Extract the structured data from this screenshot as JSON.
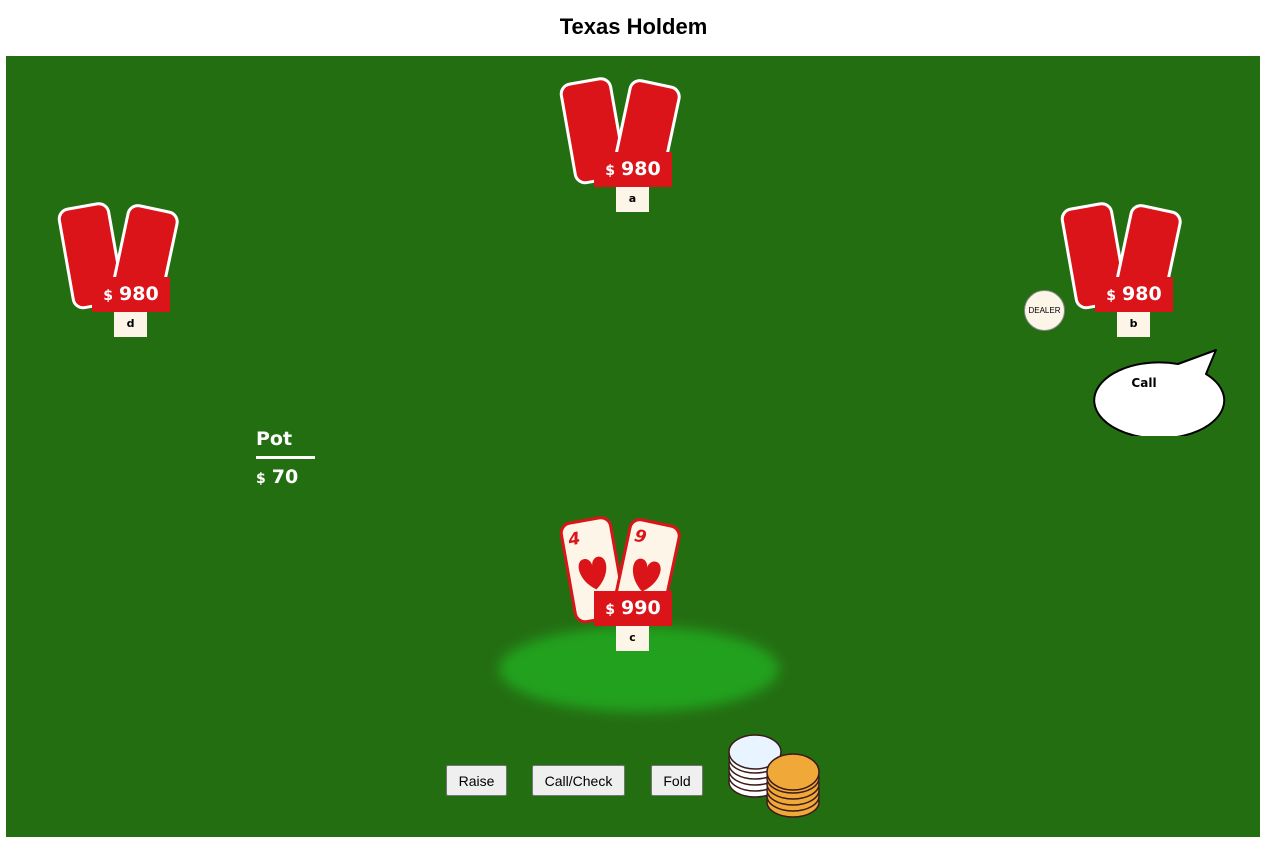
{
  "title": "Texas Holdem",
  "players": {
    "a": {
      "name": "a",
      "currency": "$",
      "stack": "980"
    },
    "b": {
      "name": "b",
      "currency": "$",
      "stack": "980"
    },
    "c": {
      "name": "c",
      "currency": "$",
      "stack": "990"
    },
    "d": {
      "name": "d",
      "currency": "$",
      "stack": "980"
    }
  },
  "hero_cards": [
    {
      "rank": "4",
      "suit": "hearts"
    },
    {
      "rank": "9",
      "suit": "hearts"
    }
  ],
  "dealer_label": "DEALER",
  "speech": "Call",
  "pot": {
    "label": "Pot",
    "currency": "$",
    "value": "70"
  },
  "buttons": {
    "raise": "Raise",
    "call_check": "Call/Check",
    "fold": "Fold"
  },
  "colors": {
    "felt": "#246e12",
    "spotlight": "#22a11e",
    "card_back": "#db141a",
    "card_face": "#fdf6e8",
    "chip_gold": "#f0a838",
    "chip_white": "#e8f4ff"
  }
}
